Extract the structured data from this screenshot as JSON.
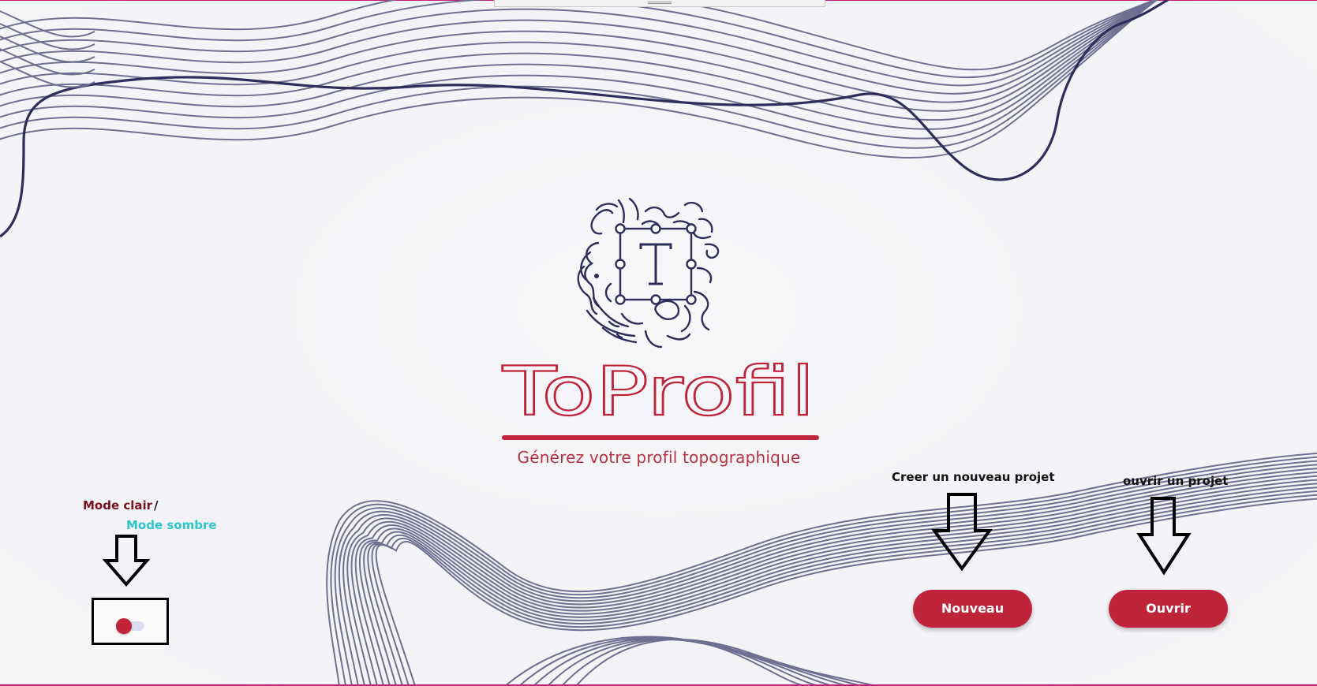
{
  "app": {
    "title": "ToProfil",
    "subtitle": "Générez votre profil topographique"
  },
  "annotations": {
    "mode_clair": "Mode clair",
    "slash": "/",
    "mode_sombre": "Mode sombre",
    "nouveau_hint": "Creer un nouveau projet",
    "ouvrir_hint": "ouvrir un projet"
  },
  "buttons": {
    "nouveau": "Nouveau",
    "ouvrir": "Ouvrir"
  },
  "theme_toggle": {
    "state": "clair"
  },
  "colors": {
    "brand_red": "#c0243a",
    "wave_line": "#6f6f92",
    "wave_dark": "#2e2d5c",
    "logo_navy": "#2e2d5c",
    "mode_sombre_text": "#2cc6cf",
    "mode_clair_text": "#7a1020"
  },
  "icons": {
    "logo": "topographic-T-logo",
    "arrow": "down-arrow-outline"
  }
}
